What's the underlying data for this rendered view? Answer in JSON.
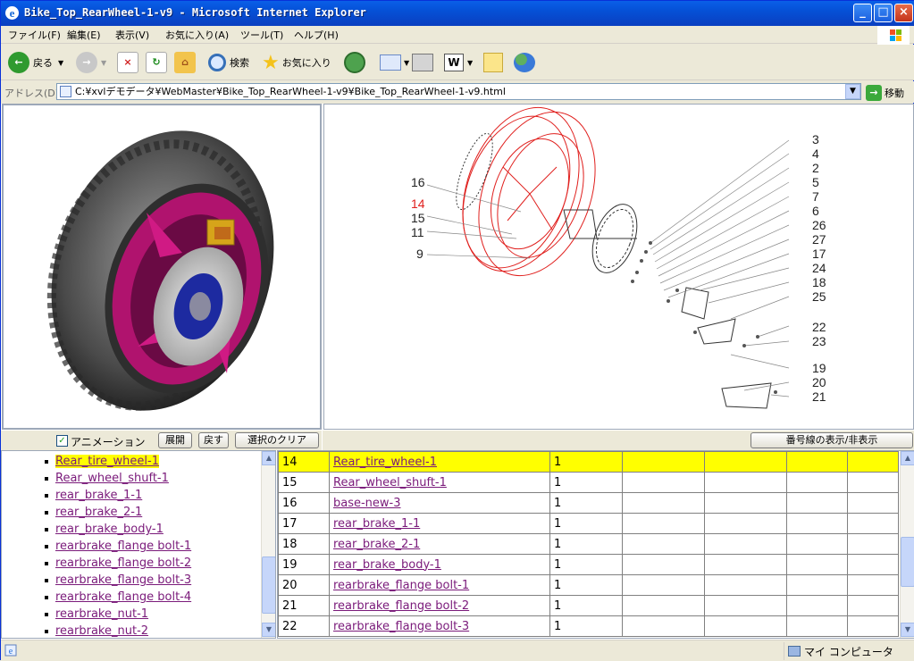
{
  "window": {
    "title": "Bike_Top_RearWheel-1-v9 - Microsoft Internet Explorer",
    "min": "_",
    "max": "□",
    "close": "×"
  },
  "menu": [
    "ファイル(F)",
    "編集(E)",
    "表示(V)",
    "お気に入り(A)",
    "ツール(T)",
    "ヘルプ(H)"
  ],
  "toolbar": {
    "back": "戻る",
    "search": "検索",
    "favorites": "お気に入り"
  },
  "address": {
    "label": "アドレス(D)",
    "url": "C:¥xvlデモデータ¥WebMaster¥Bike_Top_RearWheel-1-v9¥Bike_Top_RearWheel-1-v9.html",
    "go": "移動"
  },
  "viewer_controls": {
    "animation_label": "アニメーション",
    "expand": "展開",
    "back": "戻す",
    "clear_selection": "選択のクリア",
    "toggle_callouts": "番号線の表示/非表示"
  },
  "diagram": {
    "callouts_left": [
      "16",
      "14",
      "15",
      "11",
      "9"
    ],
    "highlighted_callout": "14",
    "callouts_right": [
      "3",
      "4",
      "2",
      "5",
      "7",
      "6",
      "26",
      "27",
      "17",
      "24",
      "18",
      "25",
      "22",
      "23",
      "19",
      "20",
      "21"
    ]
  },
  "tree": {
    "items": [
      "Rear_tire_wheel-1",
      "Rear_wheel_shuft-1",
      "rear_brake_1-1",
      "rear_brake_2-1",
      "rear_brake_body-1",
      "rearbrake_flange bolt-1",
      "rearbrake_flange bolt-2",
      "rearbrake_flange bolt-3",
      "rearbrake_flange bolt-4",
      "rearbrake_nut-1",
      "rearbrake_nut-2"
    ],
    "selected_index": 0
  },
  "parts_table": {
    "rows": [
      {
        "no": "14",
        "name": "Rear_tire_wheel-1",
        "qty": "1"
      },
      {
        "no": "15",
        "name": "Rear_wheel_shuft-1",
        "qty": "1"
      },
      {
        "no": "16",
        "name": "base-new-3",
        "qty": "1"
      },
      {
        "no": "17",
        "name": "rear_brake_1-1",
        "qty": "1"
      },
      {
        "no": "18",
        "name": "rear_brake_2-1",
        "qty": "1"
      },
      {
        "no": "19",
        "name": "rear_brake_body-1",
        "qty": "1"
      },
      {
        "no": "20",
        "name": "rearbrake_flange bolt-1",
        "qty": "1"
      },
      {
        "no": "21",
        "name": "rearbrake_flange bolt-2",
        "qty": "1"
      },
      {
        "no": "22",
        "name": "rearbrake_flange bolt-3",
        "qty": "1"
      }
    ],
    "highlighted_index": 0
  },
  "status": {
    "zone": "マイ コンピュータ"
  },
  "colors": {
    "highlight": "#ffff00",
    "link": "#7a1a7a",
    "wheel_rim": "#b0136e",
    "callout_red": "#e0201e"
  }
}
